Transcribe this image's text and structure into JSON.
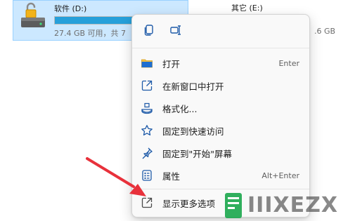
{
  "explorer": {
    "drive_d": {
      "name": "软件 (D:)",
      "free_text": "27.4 GB 可用，共 7",
      "usage": 0.96
    },
    "drive_e": {
      "name": "其它 (E:)",
      "free_text": ".6 GB"
    }
  },
  "context_menu": {
    "top_actions": [
      {
        "icon": "copy-icon"
      },
      {
        "icon": "rename-icon"
      }
    ],
    "items": [
      {
        "icon": "folder-icon",
        "label": "打开",
        "shortcut": "Enter"
      },
      {
        "icon": "open-new-window-icon",
        "label": "在新窗口中打开",
        "shortcut": ""
      },
      {
        "icon": "format-icon",
        "label": "格式化...",
        "shortcut": ""
      },
      {
        "icon": "star-icon",
        "label": "固定到快速访问",
        "shortcut": ""
      },
      {
        "icon": "pin-icon",
        "label": "固定到\"开始\"屏幕",
        "shortcut": ""
      },
      {
        "icon": "properties-icon",
        "label": "属性",
        "shortcut": "Alt+Enter"
      },
      {
        "icon": "show-more-icon",
        "label": "显示更多选项",
        "shortcut": ""
      }
    ]
  },
  "annotation": {
    "arrow_color": "#e8313b"
  },
  "colors": {
    "accent": "#0067c0",
    "selection_bg": "#cce8ff",
    "usage_bar": "#26a0da",
    "watermark_green": "#1aa64b"
  }
}
